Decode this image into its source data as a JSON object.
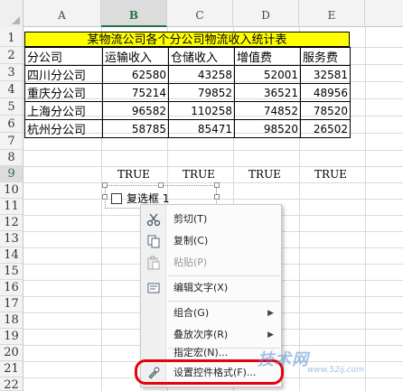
{
  "columns": [
    "A",
    "B",
    "C",
    "D",
    "E"
  ],
  "rows": [
    "1",
    "2",
    "3",
    "4",
    "5",
    "6",
    "7",
    "8",
    "9",
    "10",
    "11",
    "12",
    "13",
    "14",
    "15",
    "16",
    "17",
    "18",
    "19",
    "20",
    "21",
    "22"
  ],
  "title": "某物流公司各个分公司物流收入统计表",
  "headers": [
    "分公司",
    "运输收入",
    "仓储收入",
    "增值费",
    "服务费"
  ],
  "table": [
    [
      "四川分公司",
      "62580",
      "43258",
      "52001",
      "32581"
    ],
    [
      "重庆分公司",
      "75214",
      "79852",
      "36521",
      "48956"
    ],
    [
      "上海分公司",
      "96582",
      "110258",
      "74852",
      "78520"
    ],
    [
      "杭州分公司",
      "58785",
      "85471",
      "98520",
      "26502"
    ]
  ],
  "true_values": [
    "TRUE",
    "TRUE",
    "TRUE",
    "TRUE"
  ],
  "checkbox_label": "复选框 1",
  "menu": {
    "cut": "剪切(T)",
    "copy": "复制(C)",
    "paste": "粘贴(P)",
    "edit_text": "编辑文字(X)",
    "group": "组合(G)",
    "order": "叠放次序(R)",
    "assign_macro": "指定宏(N)...",
    "format_control": "设置控件格式(F)..."
  },
  "watermark": "技术网",
  "watermark_url": "www.52ij.com",
  "colors": {
    "title_fill": "#ffff00",
    "highlight": "#e8000c",
    "accent": "#217346"
  }
}
